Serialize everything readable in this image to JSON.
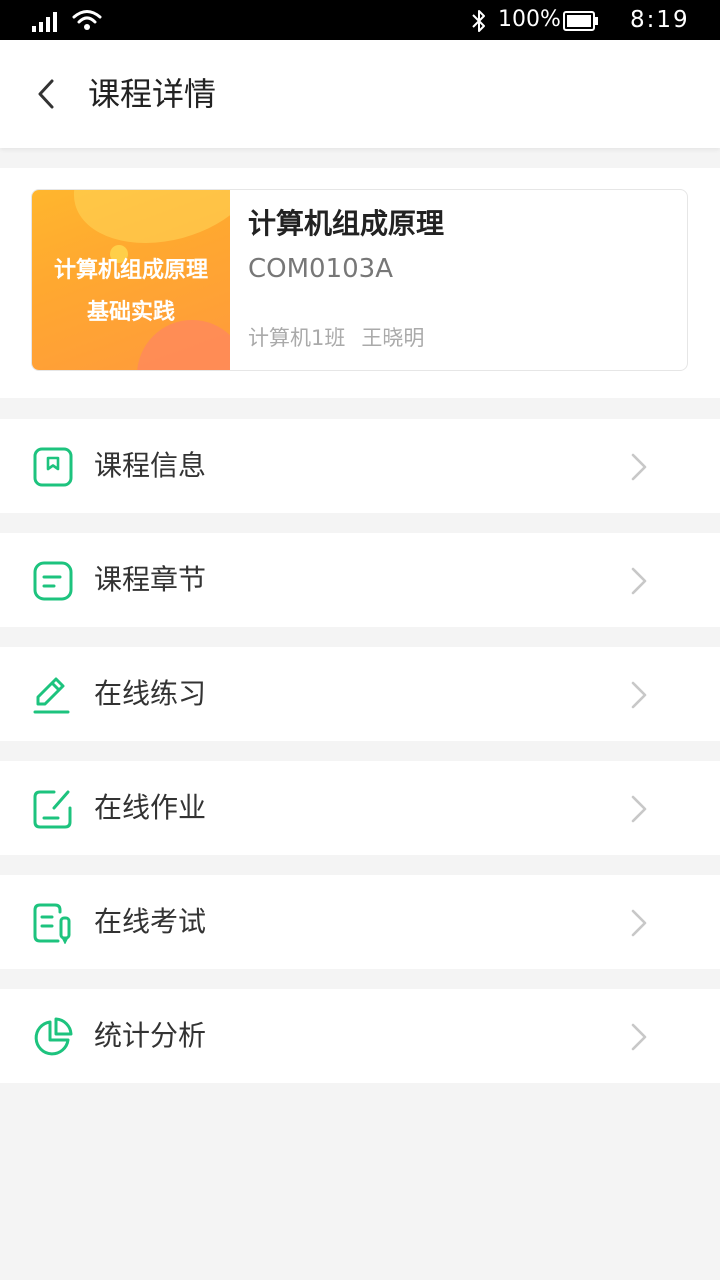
{
  "status_bar": {
    "battery_percent": "100%",
    "time": "8:19"
  },
  "header": {
    "title": "课程详情"
  },
  "course": {
    "cover_line1": "计算机组成原理",
    "cover_line2": "基础实践",
    "name": "计算机组成原理",
    "code": "COM0103A",
    "class_name": "计算机1班",
    "teacher": "王晓明"
  },
  "menu": {
    "items": [
      {
        "label": "课程信息",
        "icon": "bookmark-icon"
      },
      {
        "label": "课程章节",
        "icon": "document-icon"
      },
      {
        "label": "在线练习",
        "icon": "pencil-icon"
      },
      {
        "label": "在线作业",
        "icon": "edit-square-icon"
      },
      {
        "label": "在线考试",
        "icon": "exam-icon"
      },
      {
        "label": "统计分析",
        "icon": "pie-chart-icon"
      }
    ]
  },
  "colors": {
    "accent": "#1dc37e",
    "cover_orange": "#ffa830"
  }
}
